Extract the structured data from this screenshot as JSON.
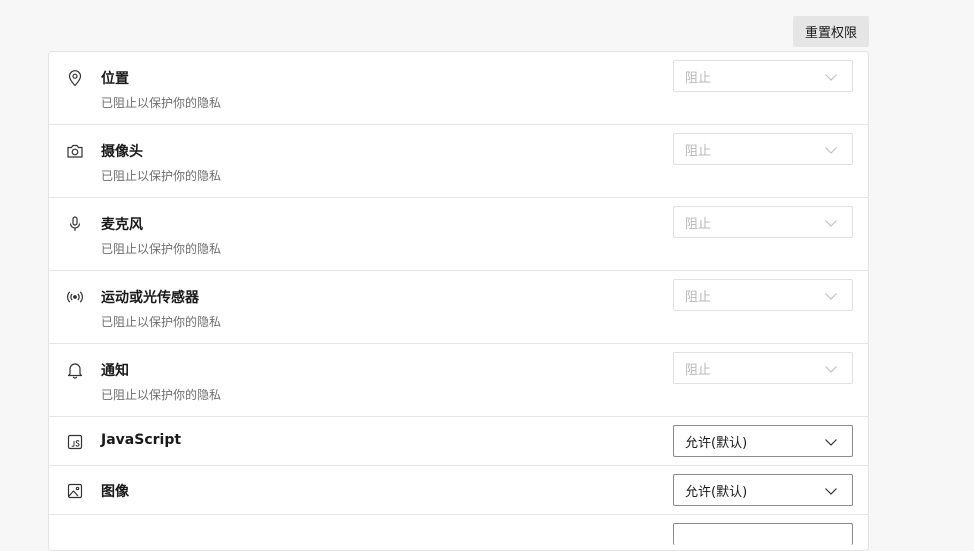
{
  "header": {
    "reset_label": "重置权限"
  },
  "permissions": [
    {
      "icon": "location-pin-icon",
      "title": "位置",
      "subtitle": "已阻止以保护你的隐私",
      "value": "阻止",
      "enabled": false
    },
    {
      "icon": "camera-icon",
      "title": "摄像头",
      "subtitle": "已阻止以保护你的隐私",
      "value": "阻止",
      "enabled": false
    },
    {
      "icon": "microphone-icon",
      "title": "麦克风",
      "subtitle": "已阻止以保护你的隐私",
      "value": "阻止",
      "enabled": false
    },
    {
      "icon": "motion-sensor-icon",
      "title": "运动或光传感器",
      "subtitle": "已阻止以保护你的隐私",
      "value": "阻止",
      "enabled": false
    },
    {
      "icon": "bell-icon",
      "title": "通知",
      "subtitle": "已阻止以保护你的隐私",
      "value": "阻止",
      "enabled": false
    },
    {
      "icon": "javascript-icon",
      "title": "JavaScript",
      "value": "允许(默认)",
      "enabled": true
    },
    {
      "icon": "image-icon",
      "title": "图像",
      "value": "允许(默认)",
      "enabled": true
    }
  ]
}
